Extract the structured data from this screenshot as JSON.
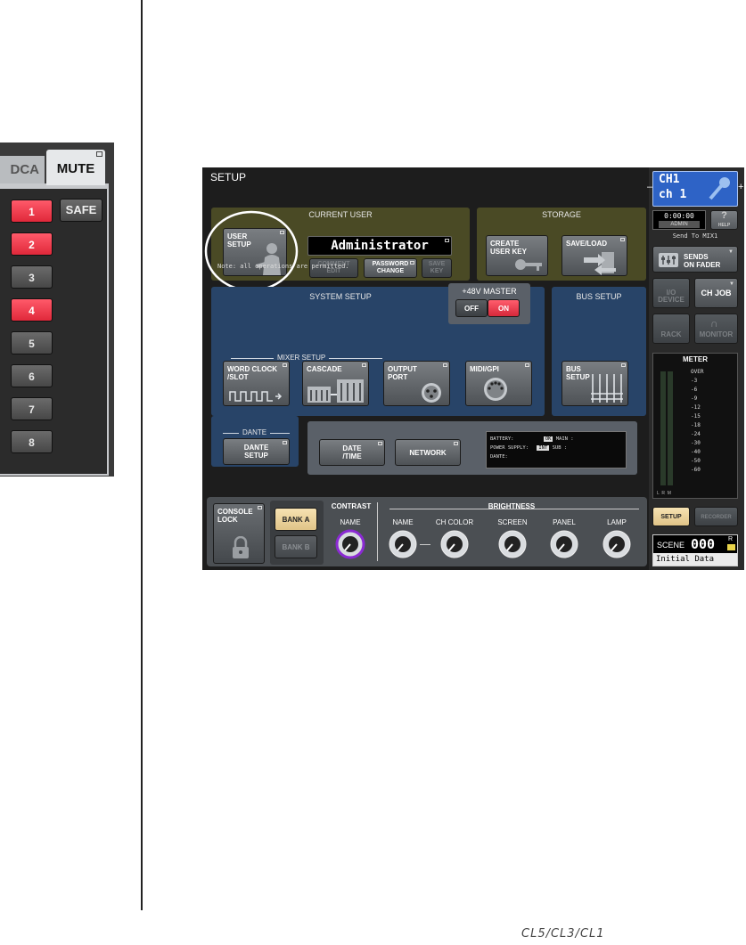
{
  "mute_panel": {
    "tab_dca": "DCA",
    "tab_mute": "MUTE",
    "safe": "SAFE",
    "groups": [
      {
        "label": "1",
        "on": true
      },
      {
        "label": "2",
        "on": true
      },
      {
        "label": "3",
        "on": false
      },
      {
        "label": "4",
        "on": true
      },
      {
        "label": "5",
        "on": false
      },
      {
        "label": "6",
        "on": false
      },
      {
        "label": "7",
        "on": false
      },
      {
        "label": "8",
        "on": false
      }
    ]
  },
  "screen": {
    "title": "SETUP",
    "current_user": {
      "title": "CURRENT USER",
      "user_setup": "USER\nSETUP",
      "user_name": "Administrator",
      "comment_edit": "COMMENT\nEDIT",
      "password_change": "PASSWORD\nCHANGE",
      "save_key": "SAVE\nKEY",
      "note": "Note: all operations are permitted."
    },
    "storage": {
      "title": "STORAGE",
      "create_user_key": "CREATE\nUSER KEY",
      "save_load": "SAVE/LOAD"
    },
    "system_setup": {
      "title": "SYSTEM SETUP",
      "phantom_title": "+48V MASTER",
      "off": "OFF",
      "on": "ON",
      "mixer_setup": "MIXER SETUP",
      "word_clock": "WORD CLOCK\n/SLOT",
      "cascade": "CASCADE",
      "output_port": "OUTPUT\nPORT",
      "midi_gpi": "MIDI/GPI",
      "dante_title": "DANTE",
      "dante_setup": "DANTE\nSETUP",
      "date_time": "DATE\n/TIME",
      "network": "NETWORK",
      "status": {
        "battery": "BATTERY:",
        "battery_val": "OK",
        "main": "MAIN :",
        "power": "POWER SUPPLY:",
        "power_val": "INT",
        "sub": "SUB :",
        "dante": "DANTE:"
      }
    },
    "bus_setup": {
      "title": "BUS SETUP",
      "btn": "BUS\nSETUP"
    },
    "bottom": {
      "console_lock": "CONSOLE\nLOCK",
      "bank_a": "BANK A",
      "bank_b": "BANK B",
      "contrast": "CONTRAST",
      "brightness": "BRIGHTNESS",
      "knobs": [
        "NAME",
        "NAME",
        "CH COLOR",
        "SCREEN",
        "PANEL",
        "LAMP"
      ]
    },
    "sidebar": {
      "ch_top": "CH1",
      "ch_bottom": "ch 1",
      "time": "0:00:00",
      "user": "ADMIN",
      "help": "?",
      "help_sub": "HELP",
      "send_to": "Send To MIX1",
      "sends_on_fader": "SENDS\nON FADER",
      "io_device": "I/O\nDEVICE",
      "ch_job": "CH JOB",
      "rack": "RACK",
      "monitor": "MONITOR",
      "meter": "METER",
      "meter_scale": [
        "OVER",
        "-3",
        "-6",
        "-9",
        "-12",
        "-15",
        "-18",
        "-24",
        "-30",
        "-40",
        "-50",
        "-60"
      ],
      "meter_lrm": "L  R  M",
      "setup": "SETUP",
      "recorder": "RECORDER",
      "scene_label": "SCENE",
      "scene_num": "000",
      "scene_name": "Initial Data",
      "scene_r": "R"
    }
  },
  "footer_logo": "CL5/CL3/CL1"
}
